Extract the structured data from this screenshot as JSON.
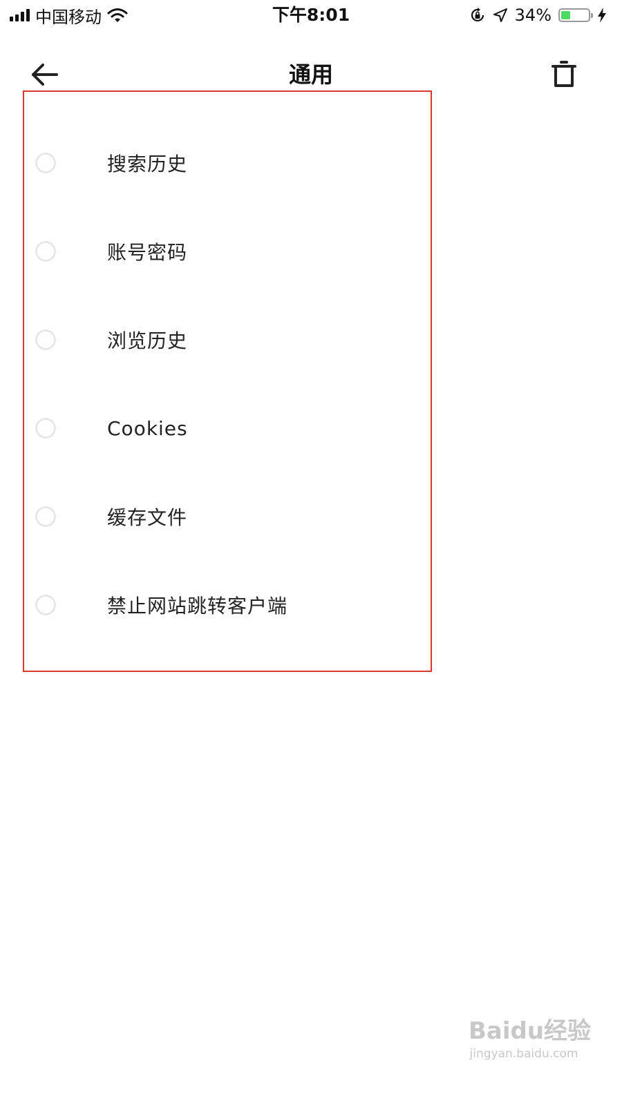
{
  "status_bar": {
    "carrier": "中国移动",
    "time": "下午8:01",
    "battery_percent": "34%",
    "battery_level": 0.34,
    "battery_color": "#4cd964"
  },
  "header": {
    "title": "通用",
    "back_icon": "arrow-left-icon",
    "trash_icon": "trash-icon"
  },
  "options": [
    {
      "label": "搜索历史",
      "checked": false
    },
    {
      "label": "账号密码",
      "checked": false
    },
    {
      "label": "浏览历史",
      "checked": false
    },
    {
      "label": "Cookies",
      "checked": false
    },
    {
      "label": "缓存文件",
      "checked": false
    },
    {
      "label": "禁止网站跳转客户端",
      "checked": false
    }
  ],
  "highlight_color": "#d9382c",
  "watermark": {
    "logo": "Baidu经验",
    "url": "jingyan.baidu.com"
  }
}
